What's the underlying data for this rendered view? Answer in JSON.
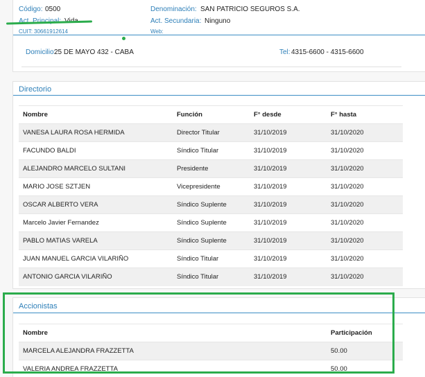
{
  "company": {
    "codigo_label": "Código:",
    "codigo_value": "0500",
    "denominacion_label": "Denominación:",
    "denominacion_value": "SAN PATRICIO SEGUROS S.A.",
    "act_principal_label": "Act. Principal:",
    "act_principal_value": "Vida",
    "act_secundaria_label": "Act. Secundaria:",
    "act_secundaria_value": "Ninguno",
    "cuit_label": "CUIT:",
    "cuit_value": "30661912614",
    "web_label": "Web:",
    "domicilio_label": "Domicilio:",
    "domicilio_value": "25 DE MAYO 432 - CABA",
    "tel_label": "Tel:",
    "tel_value": "4315-6600 - 4315-6600"
  },
  "directorio": {
    "title": "Directorio",
    "headers": [
      "Nombre",
      "Función",
      "F° desde",
      "F° hasta"
    ],
    "rows": [
      [
        "VANESA LAURA ROSA HERMIDA",
        "Director Titular",
        "31/10/2019",
        "31/10/2020"
      ],
      [
        "FACUNDO BALDI",
        "Síndico Titular",
        "31/10/2019",
        "31/10/2020"
      ],
      [
        "ALEJANDRO MARCELO SULTANI",
        "Presidente",
        "31/10/2019",
        "31/10/2020"
      ],
      [
        "MARIO JOSE SZTJEN",
        "Vicepresidente",
        "31/10/2019",
        "31/10/2020"
      ],
      [
        "OSCAR ALBERTO VERA",
        "Síndico Suplente",
        "31/10/2019",
        "31/10/2020"
      ],
      [
        "Marcelo Javier Fernandez",
        "Síndico Suplente",
        "31/10/2019",
        "31/10/2020"
      ],
      [
        "PABLO MATIAS VARELA",
        "Síndico Suplente",
        "31/10/2019",
        "31/10/2020"
      ],
      [
        "JUAN MANUEL GARCIA VILARIÑO",
        "Síndico Titular",
        "31/10/2019",
        "31/10/2020"
      ],
      [
        "ANTONIO GARCIA VILARIÑO",
        "Síndico Titular",
        "31/10/2019",
        "31/10/2020"
      ]
    ]
  },
  "accionistas": {
    "title": "Accionistas",
    "headers": [
      "Nombre",
      "Participación"
    ],
    "rows": [
      [
        "MARCELA ALEJANDRA FRAZZETTA",
        "50.00"
      ],
      [
        "VALERIA ANDREA FRAZZETTA",
        "50.00"
      ]
    ]
  },
  "colors": {
    "label_blue": "#2d7fb8",
    "rule_blue": "#3b8dc4",
    "highlight_green": "#2bac4c",
    "row_stripe": "#f0f0f0"
  }
}
